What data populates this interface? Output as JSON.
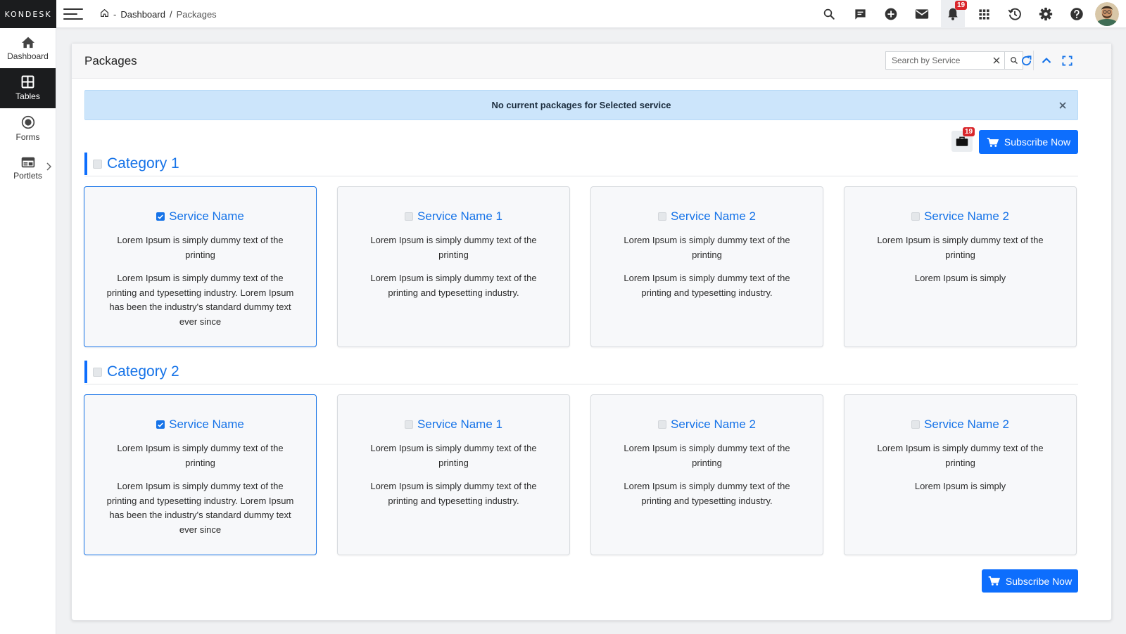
{
  "brand": "KONDESK",
  "breadcrumb": {
    "sep_dash": "-",
    "home_label": "Dashboard",
    "sep_slash": "/",
    "current": "Packages"
  },
  "topbar": {
    "icons": [
      "search-icon",
      "chat-icon",
      "add-circle-icon",
      "mail-icon",
      "bell-icon",
      "apps-grid-icon",
      "history-icon",
      "settings-icon",
      "help-icon"
    ],
    "notification_count": "19"
  },
  "sidebar": {
    "items": [
      {
        "label": "Dashboard",
        "icon": "home-icon"
      },
      {
        "label": "Tables",
        "icon": "table-icon"
      },
      {
        "label": "Forms",
        "icon": "radio-icon"
      },
      {
        "label": "Portlets",
        "icon": "portlet-icon"
      }
    ],
    "active": "Tables"
  },
  "panel": {
    "title": "Packages",
    "search": {
      "placeholder": "Search by Service",
      "value": ""
    },
    "alert": "No current packages for Selected service",
    "cart_count": "19",
    "subscribe_label": "Subscribe Now",
    "subscribe_bottom_label": "Subscribe Now"
  },
  "categories": [
    {
      "title": "Category 1",
      "checked": false,
      "cards": [
        {
          "name": "Service Name",
          "checked": true,
          "p1": "Lorem Ipsum is simply dummy text of the printing",
          "p2": "Lorem Ipsum is simply dummy text of the printing and typesetting industry. Lorem Ipsum has been the industry's standard dummy text ever since"
        },
        {
          "name": "Service Name 1",
          "checked": false,
          "p1": "Lorem Ipsum is simply dummy text of the printing",
          "p2": "Lorem Ipsum is simply dummy text of the printing and typesetting industry."
        },
        {
          "name": "Service Name 2",
          "checked": false,
          "p1": "Lorem Ipsum is simply dummy text of the printing",
          "p2": "Lorem Ipsum is simply dummy text of the printing and typesetting industry."
        },
        {
          "name": "Service Name 2",
          "checked": false,
          "p1": "Lorem Ipsum is simply dummy text of the printing",
          "p2": "Lorem Ipsum is simply"
        }
      ]
    },
    {
      "title": "Category 2",
      "checked": false,
      "cards": [
        {
          "name": "Service Name",
          "checked": true,
          "p1": "Lorem Ipsum is simply dummy text of the printing",
          "p2": "Lorem Ipsum is simply dummy text of the printing and typesetting industry. Lorem Ipsum has been the industry's standard dummy text ever since"
        },
        {
          "name": "Service Name 1",
          "checked": false,
          "p1": "Lorem Ipsum is simply dummy text of the printing",
          "p2": "Lorem Ipsum is simply dummy text of the printing and typesetting industry."
        },
        {
          "name": "Service Name 2",
          "checked": false,
          "p1": "Lorem Ipsum is simply dummy text of the printing",
          "p2": "Lorem Ipsum is simply dummy text of the printing and typesetting industry."
        },
        {
          "name": "Service Name 2",
          "checked": false,
          "p1": "Lorem Ipsum is simply dummy text of the printing",
          "p2": "Lorem Ipsum is simply"
        }
      ]
    }
  ],
  "colors": {
    "accent": "#1673e8",
    "button": "#0d6efd",
    "alert_bg": "#cce5fb",
    "badge": "#d9262b",
    "brand_bg": "#1b1c1e"
  }
}
